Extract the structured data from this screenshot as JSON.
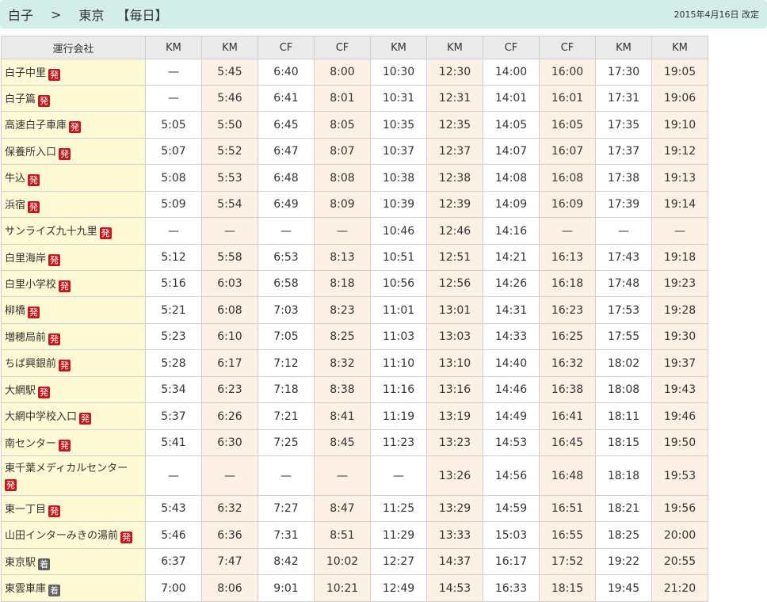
{
  "header": {
    "from": "白子",
    "arrow": ">",
    "to": "東京",
    "frequency": "【毎日】",
    "revised": "2015年4月16日 改定"
  },
  "colors": {
    "header_bg": "#d3eee8",
    "stop_bg": "#fdfad5",
    "alt_col_bg": "#fcf1e4",
    "depart_badge": "#c8161d",
    "arrive_badge": "#5f5f5f"
  },
  "table": {
    "operator_label": "運行会社",
    "operators": [
      "KM",
      "KM",
      "CF",
      "CF",
      "KM",
      "KM",
      "CF",
      "CF",
      "KM",
      "KM"
    ],
    "rows": [
      {
        "stop": "白子中里",
        "badge": "発",
        "kind": "dep",
        "times": [
          "—",
          "5:45",
          "6:40",
          "8:00",
          "10:30",
          "12:30",
          "14:00",
          "16:00",
          "17:30",
          "19:05"
        ]
      },
      {
        "stop": "白子篇",
        "badge": "発",
        "kind": "dep",
        "times": [
          "—",
          "5:46",
          "6:41",
          "8:01",
          "10:31",
          "12:31",
          "14:01",
          "16:01",
          "17:31",
          "19:06"
        ]
      },
      {
        "stop": "高速白子車庫",
        "badge": "発",
        "kind": "dep",
        "times": [
          "5:05",
          "5:50",
          "6:45",
          "8:05",
          "10:35",
          "12:35",
          "14:05",
          "16:05",
          "17:35",
          "19:10"
        ]
      },
      {
        "stop": "保養所入口",
        "badge": "発",
        "kind": "dep",
        "times": [
          "5:07",
          "5:52",
          "6:47",
          "8:07",
          "10:37",
          "12:37",
          "14:07",
          "16:07",
          "17:37",
          "19:12"
        ]
      },
      {
        "stop": "牛込",
        "badge": "発",
        "kind": "dep",
        "times": [
          "5:08",
          "5:53",
          "6:48",
          "8:08",
          "10:38",
          "12:38",
          "14:08",
          "16:08",
          "17:38",
          "19:13"
        ]
      },
      {
        "stop": "浜宿",
        "badge": "発",
        "kind": "dep",
        "times": [
          "5:09",
          "5:54",
          "6:49",
          "8:09",
          "10:39",
          "12:39",
          "14:09",
          "16:09",
          "17:39",
          "19:14"
        ]
      },
      {
        "stop": "サンライズ九十九里",
        "badge": "発",
        "kind": "dep",
        "times": [
          "—",
          "—",
          "—",
          "—",
          "10:46",
          "12:46",
          "14:16",
          "—",
          "—",
          "—"
        ]
      },
      {
        "stop": "白里海岸",
        "badge": "発",
        "kind": "dep",
        "times": [
          "5:12",
          "5:58",
          "6:53",
          "8:13",
          "10:51",
          "12:51",
          "14:21",
          "16:13",
          "17:43",
          "19:18"
        ]
      },
      {
        "stop": "白里小学校",
        "badge": "発",
        "kind": "dep",
        "times": [
          "5:16",
          "6:03",
          "6:58",
          "8:18",
          "10:56",
          "12:56",
          "14:26",
          "16:18",
          "17:48",
          "19:23"
        ]
      },
      {
        "stop": "柳橋",
        "badge": "発",
        "kind": "dep",
        "times": [
          "5:21",
          "6:08",
          "7:03",
          "8:23",
          "11:01",
          "13:01",
          "14:31",
          "16:23",
          "17:53",
          "19:28"
        ]
      },
      {
        "stop": "増穂局前",
        "badge": "発",
        "kind": "dep",
        "times": [
          "5:23",
          "6:10",
          "7:05",
          "8:25",
          "11:03",
          "13:03",
          "14:33",
          "16:25",
          "17:55",
          "19:30"
        ]
      },
      {
        "stop": "ちば興銀前",
        "badge": "発",
        "kind": "dep",
        "times": [
          "5:28",
          "6:17",
          "7:12",
          "8:32",
          "11:10",
          "13:10",
          "14:40",
          "16:32",
          "18:02",
          "19:37"
        ]
      },
      {
        "stop": "大網駅",
        "badge": "発",
        "kind": "dep",
        "times": [
          "5:34",
          "6:23",
          "7:18",
          "8:38",
          "11:16",
          "13:16",
          "14:46",
          "16:38",
          "18:08",
          "19:43"
        ]
      },
      {
        "stop": "大網中学校入口",
        "badge": "発",
        "kind": "dep",
        "times": [
          "5:37",
          "6:26",
          "7:21",
          "8:41",
          "11:19",
          "13:19",
          "14:49",
          "16:41",
          "18:11",
          "19:46"
        ]
      },
      {
        "stop": "南センター",
        "badge": "発",
        "kind": "dep",
        "times": [
          "5:41",
          "6:30",
          "7:25",
          "8:45",
          "11:23",
          "13:23",
          "14:53",
          "16:45",
          "18:15",
          "19:50"
        ]
      },
      {
        "stop": "東千葉メディカルセンター",
        "badge": "発",
        "kind": "dep",
        "times": [
          "—",
          "—",
          "—",
          "—",
          "—",
          "13:26",
          "14:56",
          "16:48",
          "18:18",
          "19:53"
        ]
      },
      {
        "stop": "東一丁目",
        "badge": "発",
        "kind": "dep",
        "times": [
          "5:43",
          "6:32",
          "7:27",
          "8:47",
          "11:25",
          "13:29",
          "14:59",
          "16:51",
          "18:21",
          "19:56"
        ]
      },
      {
        "stop": "山田インターみきの湯前",
        "badge": "発",
        "kind": "dep",
        "times": [
          "5:46",
          "6:36",
          "7:31",
          "8:51",
          "11:29",
          "13:33",
          "15:03",
          "16:55",
          "18:25",
          "20:00"
        ]
      },
      {
        "stop": "東京駅",
        "badge": "着",
        "kind": "arr",
        "times": [
          "6:37",
          "7:47",
          "8:42",
          "10:02",
          "12:27",
          "14:37",
          "16:17",
          "17:52",
          "19:22",
          "20:55"
        ]
      },
      {
        "stop": "東雲車庫",
        "badge": "着",
        "kind": "arr",
        "times": [
          "7:00",
          "8:06",
          "9:01",
          "10:21",
          "12:49",
          "14:53",
          "16:33",
          "18:15",
          "19:45",
          "21:20"
        ]
      }
    ]
  }
}
